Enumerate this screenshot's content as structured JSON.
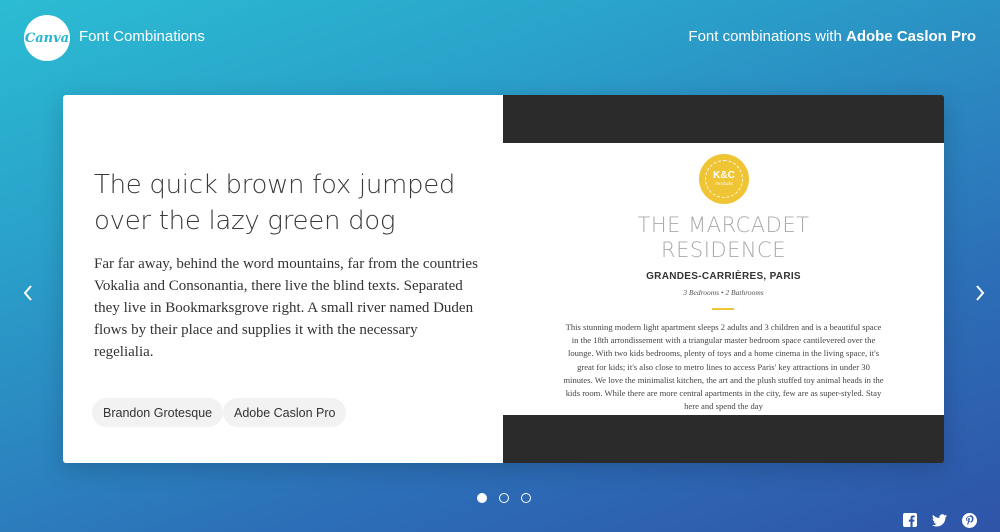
{
  "header": {
    "logo_text": "Canva",
    "site_title": "Font Combinations",
    "combo_prefix": "Font combinations with",
    "combo_font": "Adobe Caslon Pro"
  },
  "card": {
    "heading": "The quick brown fox jumped over the lazy green dog",
    "body": "Far far away, behind the word mountains, far from the countries Vokalia and Consonantia, there live the blind texts. Separated they live in Bookmarksgrove right. A small river named Duden flows by their place and supplies it with the necessary regelialia.",
    "fonts": [
      "Brandon Grotesque",
      "Adobe Caslon Pro"
    ]
  },
  "preview": {
    "badge_title": "K&C",
    "badge_sub": "rentals",
    "title_line1": "THE MARCADET",
    "title_line2": "RESIDENCE",
    "location": "GRANDES-CARRIÈRES, PARIS",
    "rooms": "3 Bedrooms • 2 Bathrooms",
    "description": "This stunning modern light apartment sleeps 2 adults and 3 children and is a beautiful space in the 18th arrondissement with a triangular master bedroom space cantilevered over the lounge. With two kids bedrooms, plenty of toys and a home cinema in the living space, it's great for kids; it's also close to metro lines to access Paris' key attractions in under 30 minutes. We love the minimalist kitchen, the art and the plush stuffed toy animal heads in the kids room. While there are more central apartments in the city, few are as super-styled. Stay here and spend the day"
  },
  "carousel": {
    "slide_count": 3,
    "active_slide": 1
  },
  "social": [
    "facebook-icon",
    "twitter-icon",
    "pinterest-icon"
  ],
  "colors": {
    "accent_yellow": "#f0c535",
    "gradient_start": "#2bbcd3",
    "gradient_end": "#2f54a8"
  }
}
